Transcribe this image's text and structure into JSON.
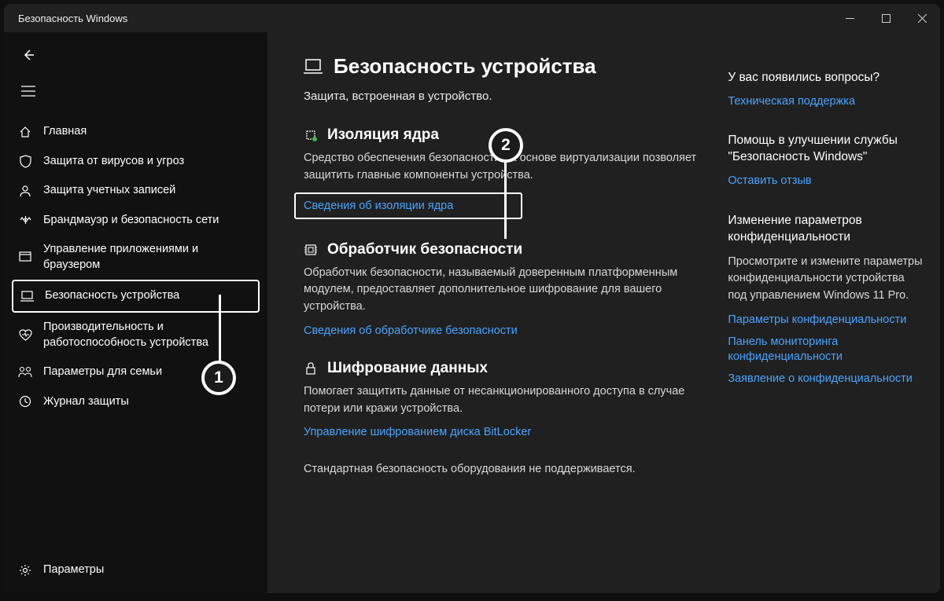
{
  "window": {
    "title": "Безопасность Windows"
  },
  "nav": {
    "items": [
      {
        "label": "Главная",
        "icon": "home-icon"
      },
      {
        "label": "Защита от вирусов и угроз",
        "icon": "shield-icon"
      },
      {
        "label": "Защита учетных записей",
        "icon": "account-icon"
      },
      {
        "label": "Брандмауэр и безопасность сети",
        "icon": "firewall-icon"
      },
      {
        "label": "Управление приложениями и браузером",
        "icon": "app-control-icon"
      },
      {
        "label": "Безопасность устройства",
        "icon": "device-icon",
        "selected": true
      },
      {
        "label": "Производительность и работоспособность устройства",
        "icon": "health-icon"
      },
      {
        "label": "Параметры для семьи",
        "icon": "family-icon"
      },
      {
        "label": "Журнал защиты",
        "icon": "history-icon"
      }
    ],
    "footer": {
      "label": "Параметры",
      "icon": "settings-icon"
    }
  },
  "page": {
    "title": "Безопасность устройства",
    "subtitle": "Защита, встроенная в устройство.",
    "sections": [
      {
        "title": "Изоляция ядра",
        "desc": "Средство обеспечения безопасности на основе виртуализации позволяет защитить главные компоненты устройства.",
        "link": "Сведения об изоляции ядра"
      },
      {
        "title": "Обработчик безопасности",
        "desc": "Обработчик безопасности, называемый доверенным платформенным модулем, предоставляет дополнительное шифрование для вашего устройства.",
        "link": "Сведения об обработчике безопасности"
      },
      {
        "title": "Шифрование данных",
        "desc": "Помогает защитить данные от несанкционированного доступа в случае потери или кражи устройства.",
        "link": "Управление шифрованием диска BitLocker"
      }
    ],
    "footnote": "Стандартная безопасность оборудования не поддерживается."
  },
  "side": [
    {
      "title": "У вас появились вопросы?",
      "links": [
        "Техническая поддержка"
      ]
    },
    {
      "title": "Помощь в улучшении службы \"Безопасность Windows\"",
      "links": [
        "Оставить отзыв"
      ]
    },
    {
      "title": "Изменение параметров конфиденциальности",
      "desc": "Просмотрите и измените параметры конфиденциальности устройства под управлением Windows 11 Pro.",
      "links": [
        "Параметры конфиденциальности",
        "Панель мониторинга конфиденциальности",
        "Заявление о конфиденциальности"
      ]
    }
  ],
  "markers": {
    "m1": "1",
    "m2": "2"
  }
}
